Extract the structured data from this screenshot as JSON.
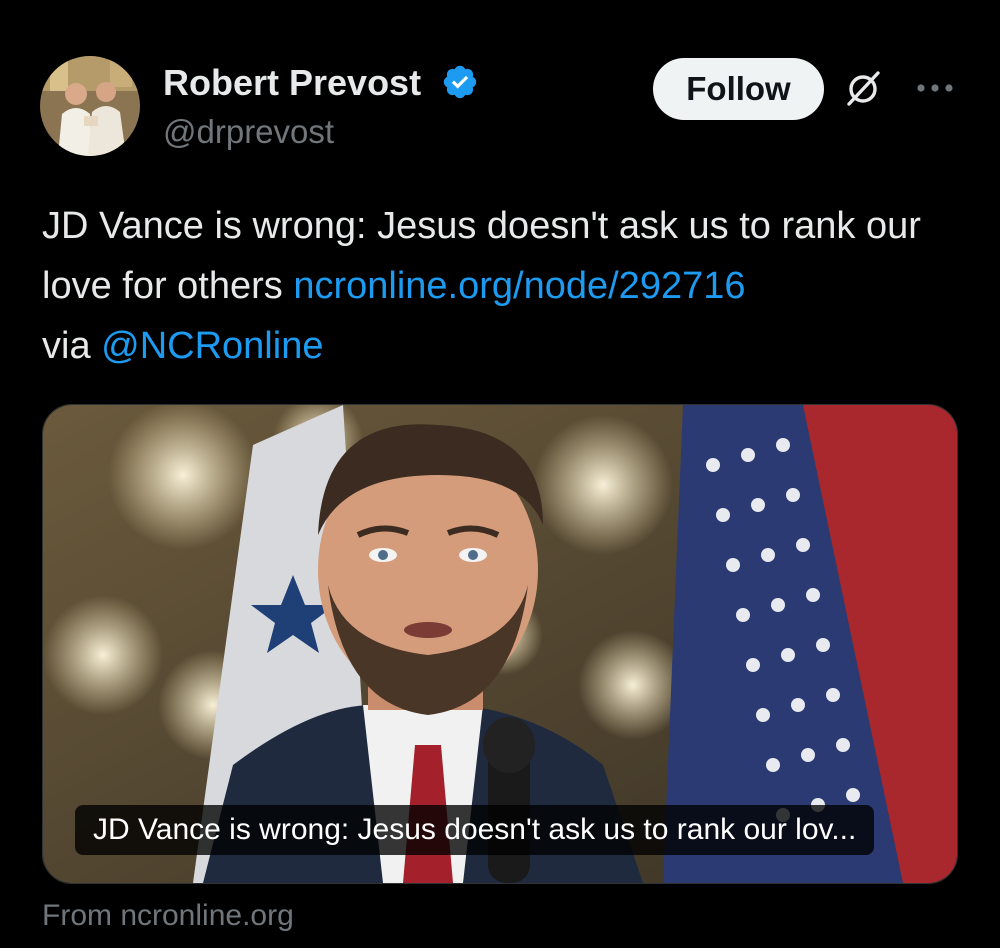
{
  "author": {
    "display_name": "Robert Prevost",
    "handle": "@drprevost",
    "verified_icon": "verified-badge-icon",
    "avatar": "profile-photo-avatar"
  },
  "actions": {
    "follow_label": "Follow",
    "grok_icon": "grok-icon",
    "more_icon": "more-options-icon"
  },
  "tweet": {
    "text_part1": "JD Vance is wrong: Jesus doesn't ask us to rank our love for others ",
    "link": "ncronline.org/node/292716",
    "text_part2": "via ",
    "mention": "@NCRonline"
  },
  "card": {
    "title": "JD Vance is wrong: Jesus doesn't ask us to rank our lov...",
    "source": "From ncronline.org",
    "image": "speaker-at-podium-photo"
  },
  "colors": {
    "background": "#000000",
    "text_primary": "#e7e9ea",
    "text_secondary": "#71767b",
    "link": "#1d9bf0",
    "verified": "#1d9bf0",
    "follow_bg": "#eff3f4"
  }
}
